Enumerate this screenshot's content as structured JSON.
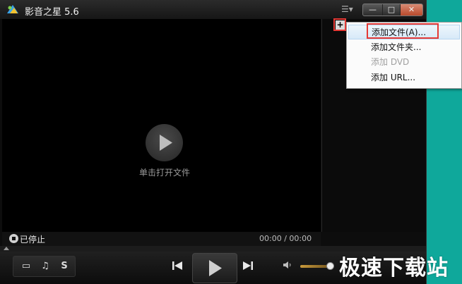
{
  "window": {
    "title": "影音之星 5.6"
  },
  "colors": {
    "accent": "#e53935",
    "desktop": "#0fa89b"
  },
  "icons": {
    "app": "app-logo",
    "menu": "list-menu-icon",
    "minimize": "minimize-icon",
    "maximize": "maximize-icon",
    "close": "close-icon"
  },
  "video": {
    "hint": "单击打开文件"
  },
  "context_menu": {
    "items": [
      {
        "label": "添加文件(A)...",
        "state": "selected"
      },
      {
        "label": "添加文件夹...",
        "state": "normal"
      },
      {
        "label": "添加 DVD",
        "state": "disabled"
      },
      {
        "label": "添加 URL...",
        "state": "normal"
      }
    ]
  },
  "status": {
    "text": "已停止",
    "time": "00:00 / 00:00"
  },
  "controls": {
    "video_mode": "▭",
    "audio_mode": "♫",
    "subtitle_mode": "S"
  },
  "watermark": "极速下载站"
}
